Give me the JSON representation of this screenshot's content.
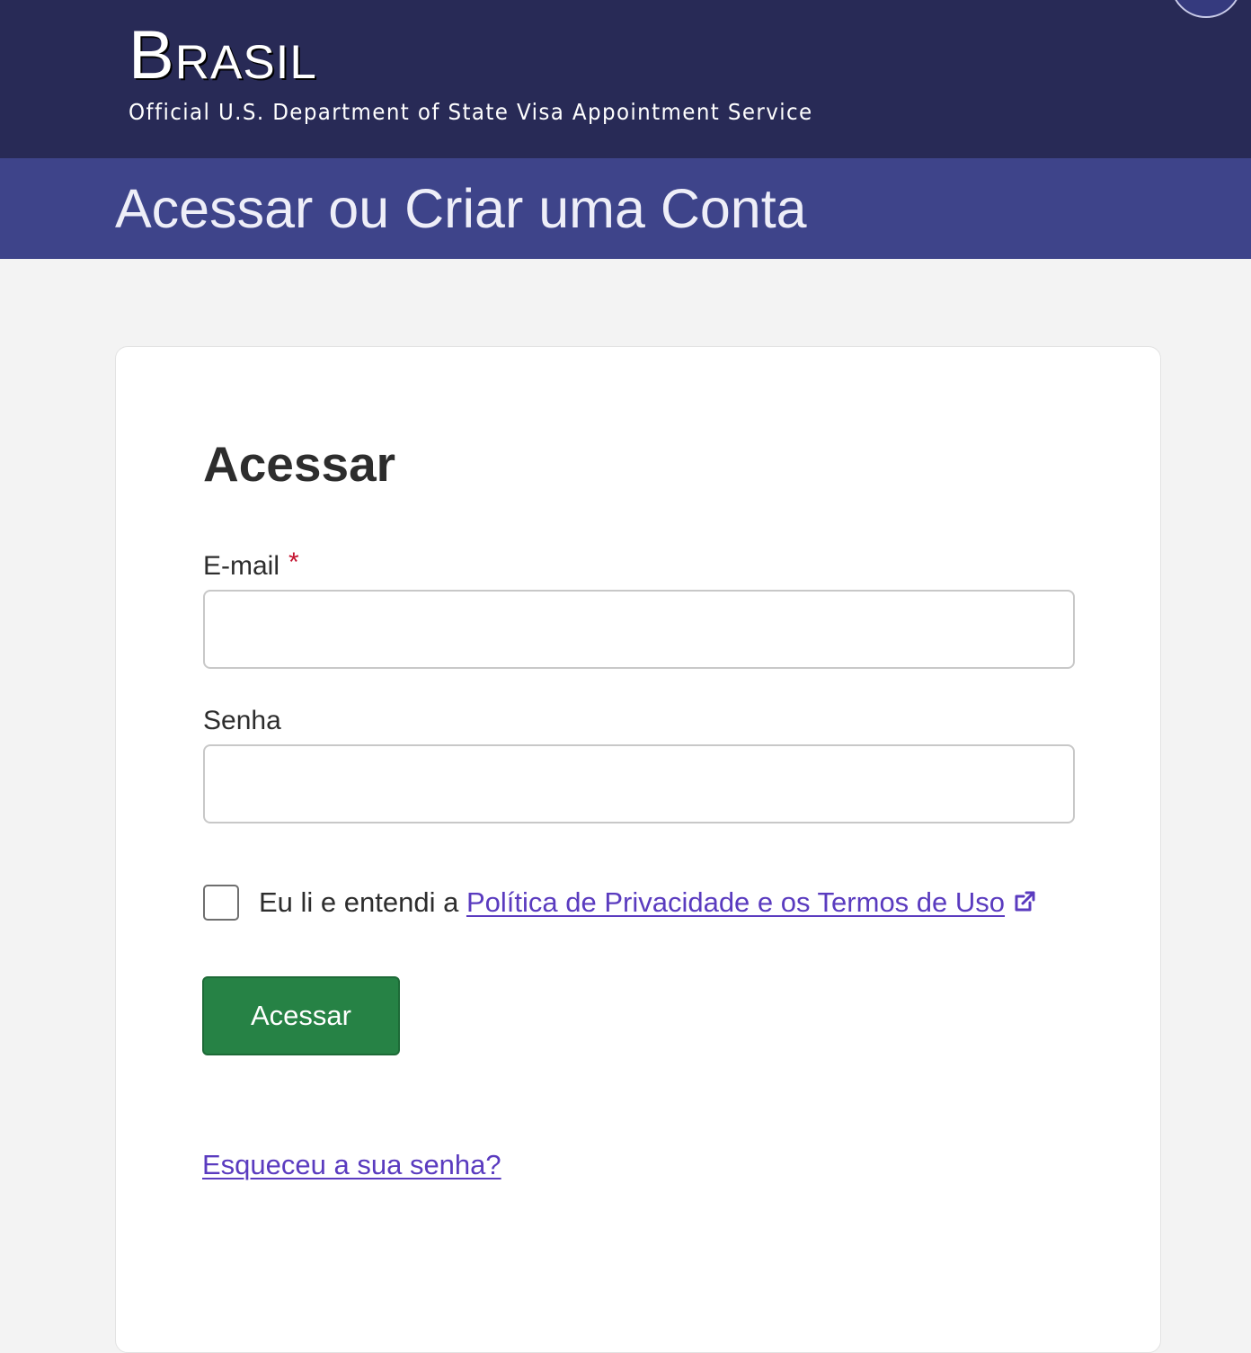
{
  "header": {
    "country": "Brasil",
    "tagline": "Official U.S. Department of State Visa Appointment Service"
  },
  "title_bar": {
    "title": "Acessar ou Criar uma Conta"
  },
  "login_card": {
    "heading": "Acessar",
    "email": {
      "label": "E-mail",
      "required_mark": "*",
      "value": "",
      "placeholder": ""
    },
    "password": {
      "label": "Senha",
      "value": "",
      "placeholder": ""
    },
    "consent": {
      "checked": false,
      "text": "Eu li e entendi a",
      "link_label": "Política de Privacidade e os Termos de Uso",
      "link_icon": "external-link-icon"
    },
    "submit_label": "Acessar",
    "forgot_password_label": "Esqueceu a sua senha?"
  },
  "colors": {
    "header_bg": "#282a56",
    "title_bar_bg": "#3e448a",
    "page_bg": "#f3f3f3",
    "button_green": "#268245",
    "link_purple": "#5a3bbf",
    "required_red": "#c4122f"
  }
}
